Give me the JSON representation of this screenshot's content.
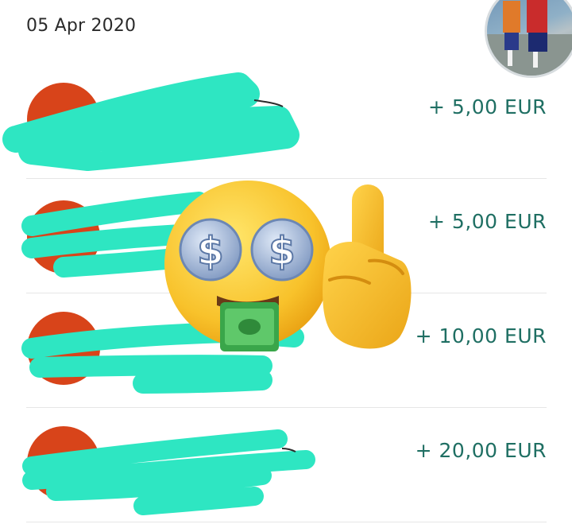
{
  "header": {
    "date": "05 Apr 2020"
  },
  "transactions": [
    {
      "amount": "+ 5,00 EUR"
    },
    {
      "amount": "+ 5,00 EUR"
    },
    {
      "amount": "+ 10,00 EUR"
    },
    {
      "amount": "+ 20,00 EUR"
    }
  ],
  "colors": {
    "amount_text": "#1f6f63",
    "avatar_placeholder": "#d8441a",
    "redaction": "#2ee6c2",
    "emoji_yellow": "#f6bd1f"
  },
  "icons": [
    "money-mouth-face-icon",
    "middle-finger-icon"
  ]
}
